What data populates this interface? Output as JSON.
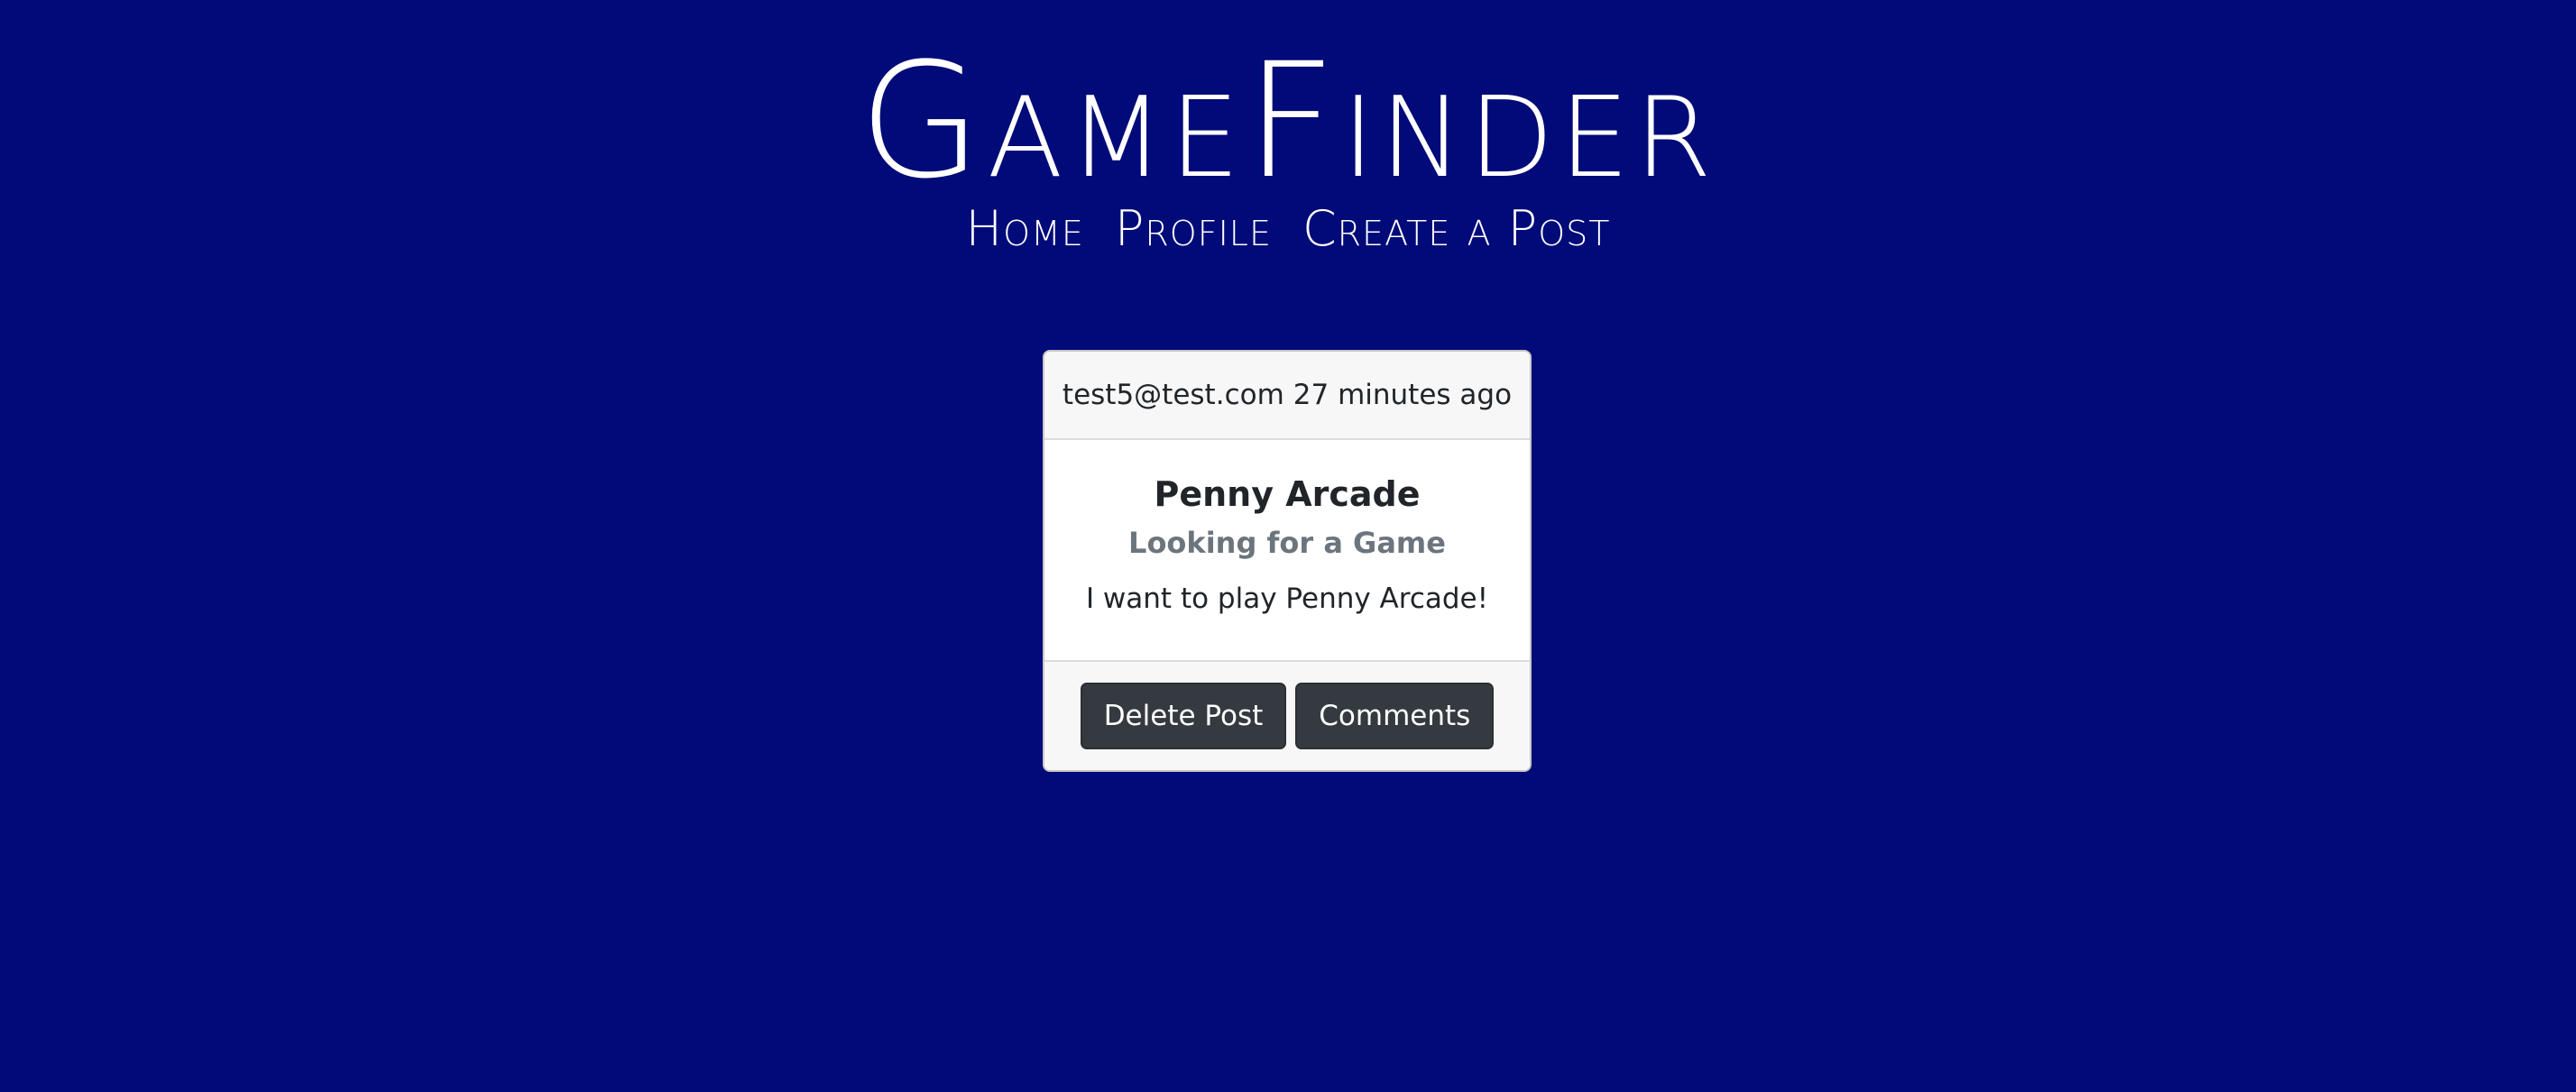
{
  "header": {
    "logo": "GameFinder",
    "nav": [
      {
        "label": "Home"
      },
      {
        "label": "Profile"
      },
      {
        "label": "Create a Post"
      }
    ]
  },
  "post": {
    "author": "test5@test.com",
    "time": "27 minutes ago",
    "title": "Penny Arcade",
    "subtitle": "Looking for a Game",
    "body": "I want to play Penny Arcade!",
    "actions": {
      "delete_label": "Delete Post",
      "comments_label": "Comments"
    }
  },
  "colors": {
    "background": "#000a78",
    "button": "#343a40",
    "card_header": "#f7f7f7",
    "subtitle": "#6c757d"
  }
}
